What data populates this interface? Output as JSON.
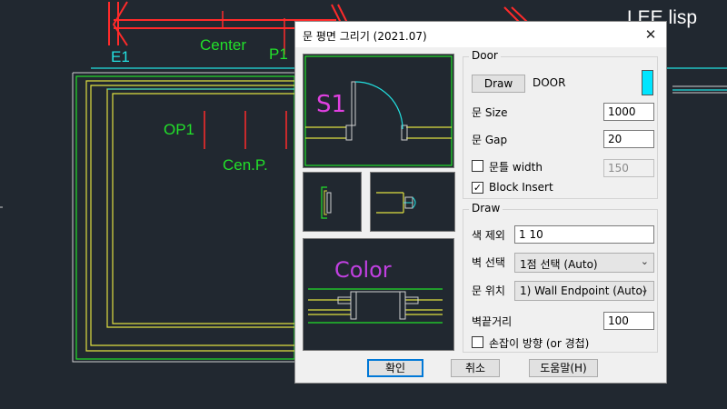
{
  "canvas": {
    "labels": {
      "e1": "E1",
      "center": "Center",
      "p1": "P1",
      "op1": "OP1",
      "cen_p": "Cen.P."
    },
    "top_right_title": "LEE.lisp"
  },
  "dialog": {
    "title": "문 평면 그리기 (2021.07)",
    "close_symbol": "✕",
    "previews": {
      "s1_label": "S1",
      "color_label": "Color"
    },
    "door_group": {
      "title": "Door",
      "draw_button": "Draw",
      "block_name": "DOOR",
      "color_swatch": "#00e5ff",
      "size_label": "문 Size",
      "size_value": "1000",
      "gap_label": "문 Gap",
      "gap_value": "20",
      "frame_width_label": "문틀 width",
      "frame_width_checked": false,
      "frame_width_value": "150",
      "block_insert_label": "Block Insert",
      "block_insert_checked": true
    },
    "draw_group": {
      "title": "Draw",
      "exclude_color_label": "색 제외",
      "exclude_color_value": "1 10",
      "wall_select_label": "벽 선택",
      "wall_select_value": "1점 선택 (Auto)",
      "door_position_label": "문 위치",
      "door_position_value": "1) Wall Endpoint (Auto)",
      "wall_end_distance_label": "벽끝거리",
      "wall_end_distance_value": "100",
      "handle_direction_label": "손잡이 방향 (or 경첩)",
      "handle_direction_checked": false
    },
    "buttons": {
      "ok": "확인",
      "cancel": "취소",
      "help": "도움말(H)"
    }
  }
}
